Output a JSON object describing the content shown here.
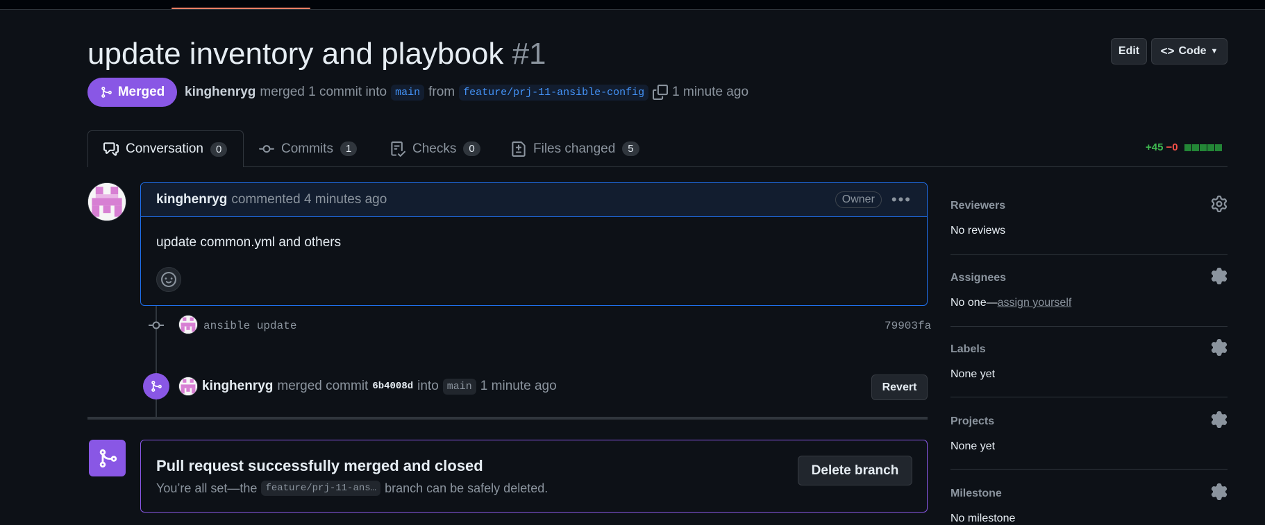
{
  "header": {
    "title": "update inventory and playbook",
    "number": "#1",
    "edit_label": "Edit",
    "code_label": "Code"
  },
  "meta": {
    "status": "Merged",
    "author": "kinghenryg",
    "action": "merged 1 commit into",
    "base_branch": "main",
    "from_word": "from",
    "head_branch": "feature/prj-11-ansible-config",
    "time": "1 minute ago"
  },
  "tabs": [
    {
      "label": "Conversation",
      "count": "0"
    },
    {
      "label": "Commits",
      "count": "1"
    },
    {
      "label": "Checks",
      "count": "0"
    },
    {
      "label": "Files changed",
      "count": "5"
    }
  ],
  "diffstat": {
    "additions": "+45",
    "deletions": "−0"
  },
  "comment": {
    "author": "kinghenryg",
    "action": "commented 4 minutes ago",
    "role": "Owner",
    "body": "update common.yml and others"
  },
  "commit": {
    "message": "ansible update",
    "sha": "79903fa"
  },
  "merge_event": {
    "author": "kinghenryg",
    "action": "merged commit",
    "sha": "6b4008d",
    "into_word": "into",
    "branch": "main",
    "time": "1 minute ago",
    "revert_label": "Revert"
  },
  "merged_box": {
    "title": "Pull request successfully merged and closed",
    "sub_prefix": "You’re all set—the",
    "branch": "feature/prj-11-ans…",
    "sub_suffix": "branch can be safely deleted.",
    "delete_label": "Delete branch"
  },
  "sidebar": {
    "reviewers": {
      "label": "Reviewers",
      "value": "No reviews"
    },
    "assignees": {
      "label": "Assignees",
      "value": "No one—",
      "link": "assign yourself"
    },
    "labels": {
      "label": "Labels",
      "value": "None yet"
    },
    "projects": {
      "label": "Projects",
      "value": "None yet"
    },
    "milestone": {
      "label": "Milestone",
      "value": "No milestone"
    }
  },
  "colors": {
    "merged": "#8957e5",
    "accent_blue": "#1f6feb",
    "add": "#3fb950",
    "del": "#f85149"
  }
}
